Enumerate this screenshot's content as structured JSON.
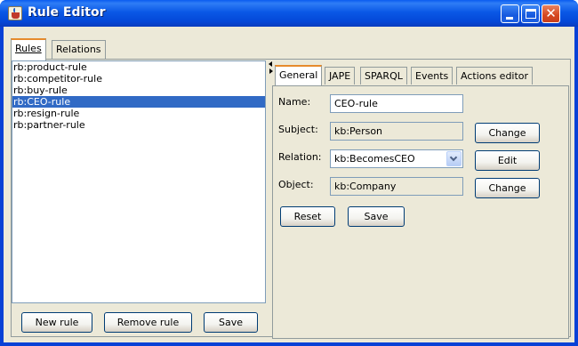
{
  "window": {
    "title": "Rule Editor",
    "accent": "#0a58e6"
  },
  "outer_tabs": [
    {
      "label": "Rules",
      "active": true
    },
    {
      "label": "Relations",
      "active": false
    }
  ],
  "rules": {
    "items": [
      "rb:product-rule",
      "rb:competitor-rule",
      "rb:buy-rule",
      "rb:CEO-rule",
      "rb:resign-rule",
      "rb:partner-rule"
    ],
    "selected": "rb:CEO-rule",
    "buttons": {
      "new": "New rule",
      "remove": "Remove rule",
      "save": "Save"
    }
  },
  "inner_tabs": [
    {
      "label": "General",
      "active": true
    },
    {
      "label": "JAPE",
      "active": false
    },
    {
      "label": "SPARQL",
      "active": false
    },
    {
      "label": "Events",
      "active": false
    },
    {
      "label": "Actions editor",
      "active": false
    }
  ],
  "general": {
    "name_label": "Name:",
    "name_value": "CEO-rule",
    "subject_label": "Subject:",
    "subject_value": "kb:Person",
    "subject_button": "Change",
    "relation_label": "Relation:",
    "relation_value": "kb:BecomesCEO",
    "relation_button": "Edit",
    "object_label": "Object:",
    "object_value": "kb:Company",
    "object_button": "Change",
    "reset_button": "Reset",
    "save_button": "Save"
  }
}
